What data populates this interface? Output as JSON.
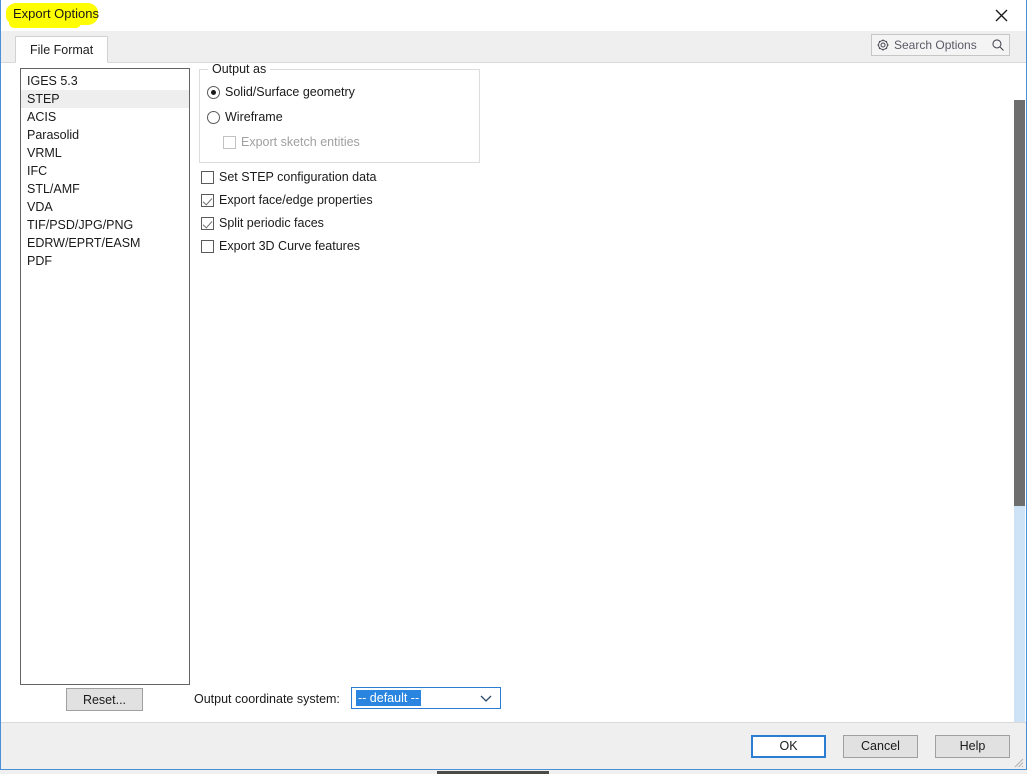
{
  "window": {
    "title": "Export Options",
    "close_icon": "close-icon",
    "title_highlight_color": "#ffff00",
    "border_color": "#4a90d9"
  },
  "tabs": [
    {
      "label": "File Format",
      "selected": true
    }
  ],
  "search": {
    "placeholder": "Search Options",
    "gear_icon": "gear-icon",
    "magnifier_icon": "search-icon"
  },
  "format_list": {
    "selected": "STEP",
    "items": [
      {
        "label": "IGES 5.3",
        "selected": false
      },
      {
        "label": "STEP",
        "selected": true
      },
      {
        "label": "ACIS",
        "selected": false
      },
      {
        "label": "Parasolid",
        "selected": false
      },
      {
        "label": "VRML",
        "selected": false
      },
      {
        "label": "IFC",
        "selected": false
      },
      {
        "label": "STL/AMF",
        "selected": false
      },
      {
        "label": "VDA",
        "selected": false
      },
      {
        "label": "TIF/PSD/JPG/PNG",
        "selected": false
      },
      {
        "label": "EDRW/EPRT/EASM",
        "selected": false
      },
      {
        "label": "PDF",
        "selected": false
      }
    ]
  },
  "output_as": {
    "legend": "Output as",
    "options": [
      {
        "label": "Solid/Surface geometry",
        "checked": true,
        "disabled": false
      },
      {
        "label": "Wireframe",
        "checked": false,
        "disabled": false
      }
    ],
    "sub_checkbox": {
      "label": "Export sketch entities",
      "checked": false,
      "disabled": true
    }
  },
  "checkboxes": [
    {
      "label": "Set STEP configuration data",
      "checked": false
    },
    {
      "label": "Export face/edge properties",
      "checked": true
    },
    {
      "label": "Split periodic faces",
      "checked": true
    },
    {
      "label": "Export 3D Curve features",
      "checked": false
    }
  ],
  "bottom_controls": {
    "reset_label": "Reset...",
    "coord_label": "Output coordinate system:",
    "coord_value": "-- default --",
    "coord_selection_color": "#2a85e0",
    "chevron_icon": "chevron-down-icon"
  },
  "footer": {
    "ok_label": "OK",
    "cancel_label": "Cancel",
    "help_label": "Help",
    "focus_color": "#2b7cd3",
    "resize_grip_icon": "resize-grip-icon"
  },
  "scrollbar": {
    "thumb_color": "#6e6e6e",
    "track_color": "#cfe3f7"
  }
}
